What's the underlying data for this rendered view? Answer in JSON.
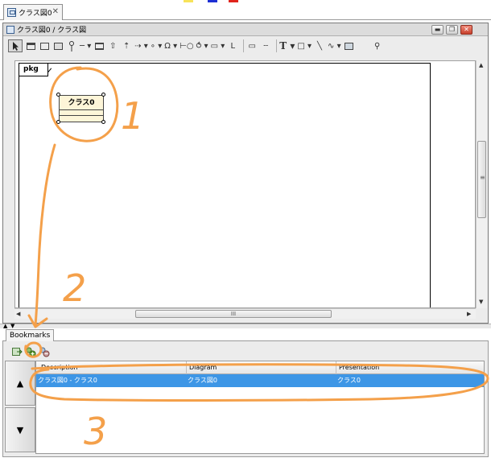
{
  "colors": {
    "accent_orange": "#f4a04a",
    "selection_blue": "#3d96e6",
    "class_fill": "#fdf5d8"
  },
  "editor": {
    "tab_label": "クラス図0",
    "tab_close": "✕",
    "window_title": "クラス図0 / クラス図",
    "window_controls": [
      "▬",
      "❐",
      "✕"
    ]
  },
  "toolbar": {
    "icons": [
      "pointer-icon",
      "class-icon",
      "package-icon",
      "subsystem-icon",
      "interface-icon",
      "association-icon",
      "association-class-icon",
      "generalization-icon",
      "realization-icon",
      "dependency-icon",
      "usage-icon",
      "provided-interface-icon",
      "required-interface-icon",
      "port-icon",
      "note-icon",
      "anchor-icon",
      "text-icon",
      "rectangle-icon",
      "line-icon",
      "curve-icon",
      "image-icon",
      "pin-icon"
    ],
    "text_tool": "T"
  },
  "diagram": {
    "frame_label": "pkg",
    "class_name": "クラス0"
  },
  "scrollbar": {
    "grip": "III",
    "vgrip": "≡"
  },
  "bookmarks": {
    "tab_label": "Bookmarks",
    "columns": [
      "Description",
      "Diagram",
      "Presentation"
    ],
    "rows": [
      {
        "description": "クラス図0 - クラス0",
        "diagram": "クラス図0",
        "presentation": "クラス0",
        "selected": true
      }
    ],
    "nav_up": "▲",
    "nav_down": "▼"
  },
  "annotations": [
    "1",
    "2",
    "3"
  ]
}
